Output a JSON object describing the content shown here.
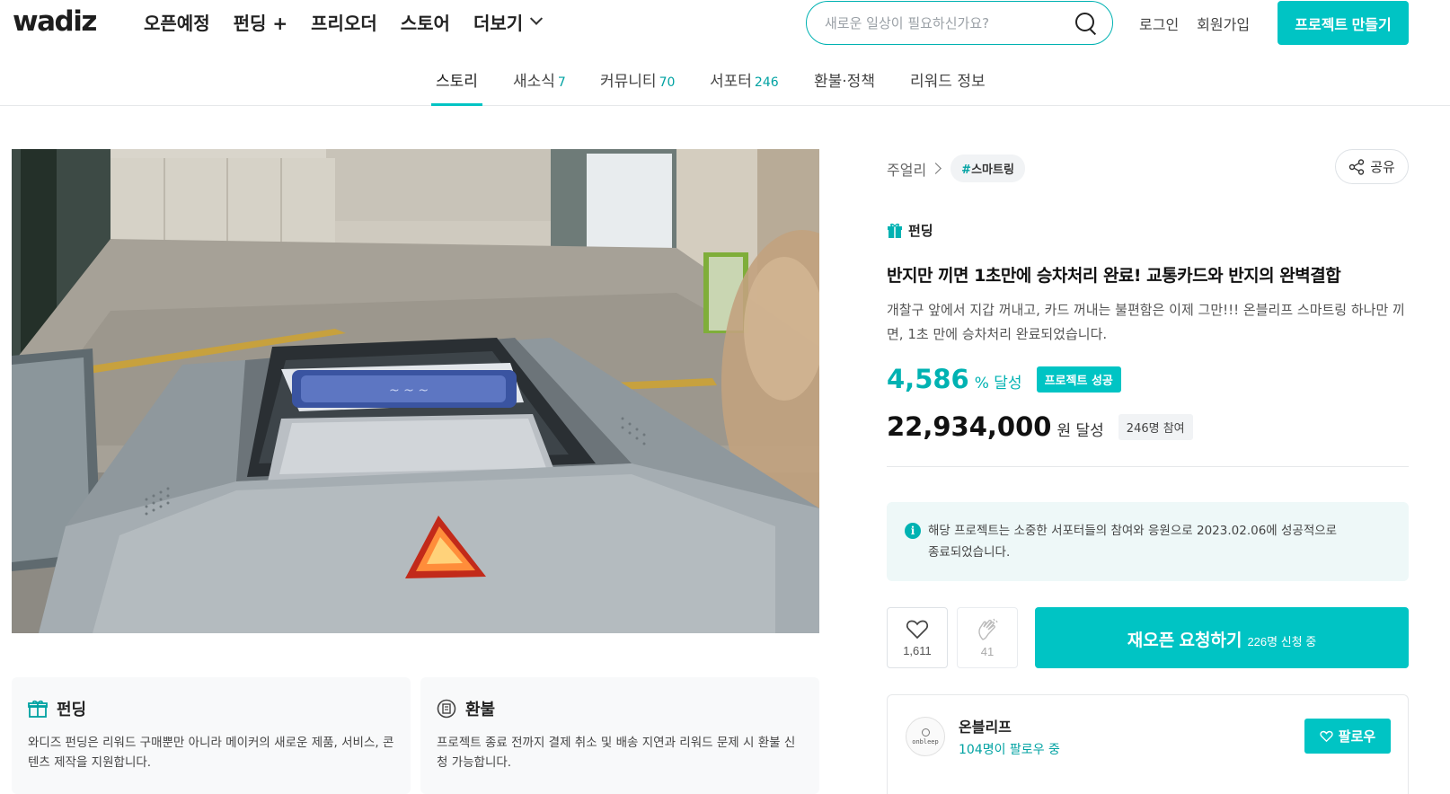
{
  "header": {
    "logo": "wadiz",
    "nav": [
      {
        "label": "오픈예정"
      },
      {
        "label": "펀딩 +"
      },
      {
        "label": "프리오더"
      },
      {
        "label": "스토어"
      },
      {
        "label": "더보기"
      }
    ],
    "search_placeholder": "새로운 일상이 필요하신가요?",
    "login": "로그인",
    "signup": "회원가입",
    "create_project": "프로젝트 만들기"
  },
  "tabs": [
    {
      "label": "스토리",
      "count": ""
    },
    {
      "label": "새소식",
      "count": "7"
    },
    {
      "label": "커뮤니티",
      "count": "70"
    },
    {
      "label": "서포터",
      "count": "246"
    },
    {
      "label": "환불·정책",
      "count": ""
    },
    {
      "label": "리워드 정보",
      "count": ""
    }
  ],
  "info_cards": {
    "funding": {
      "title": "펀딩",
      "body": "와디즈 펀딩은 리워드 구매뿐만 아니라 메이커의 새로운 제품, 서비스, 콘텐츠 제작을 지원합니다."
    },
    "refund": {
      "title": "환불",
      "body": "프로젝트 종료 전까지 결제 취소 및 배송 지연과 리워드 문제 시 환불 신청 가능합니다."
    }
  },
  "project": {
    "category": "주얼리",
    "tag": "스마트링",
    "share": "공유",
    "type_badge": "펀딩",
    "title": "반지만 끼면 1초만에 승차처리 완료! 교통카드와 반지의 완벽결합",
    "description": "개찰구 앞에서 지갑 꺼내고, 카드 꺼내는 불편함은 이제 그만!!! 온블리프 스마트링 하나만 끼면, 1초 만에 승차처리 완료되었습니다.",
    "achievement_rate": "4,586",
    "achievement_unit": "% 달성",
    "success_badge": "프로젝트 성공",
    "amount": "22,934,000",
    "amount_unit": "원 달성",
    "supporters": "246명 참여",
    "notice": "해당 프로젝트는 소중한 서포터들의 참여와 응원으로 2023.02.06에 성공적으로 종료되었습니다.",
    "likes": "1,611",
    "claps": "41",
    "reopen_label": "재오픈 요청하기",
    "reopen_count": "226명 신청 중"
  },
  "maker": {
    "avatar_text": "onbleep",
    "name": "온블리프",
    "followers": "104명이 팔로우 중",
    "follow_label": "팔로우"
  },
  "colors": {
    "accent": "#00c4c4",
    "accent_text": "#00b2b2",
    "notice_bg": "#eef8f8"
  }
}
